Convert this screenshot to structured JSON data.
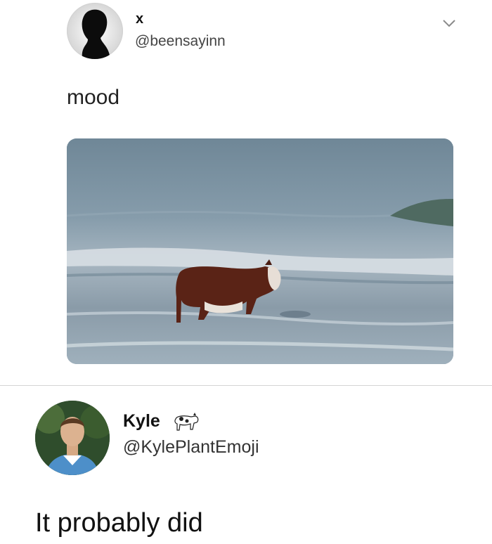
{
  "tweet": {
    "author_name": "x",
    "author_handle": "@beensayinn",
    "text": "mood",
    "media_description": "photo"
  },
  "reply": {
    "author_name": "Kyle",
    "author_emoji": "cow-emoji",
    "author_handle": "@KylePlantEmoji",
    "text": "It probably did"
  },
  "icons": {
    "more_menu": "chevron-down-icon"
  }
}
